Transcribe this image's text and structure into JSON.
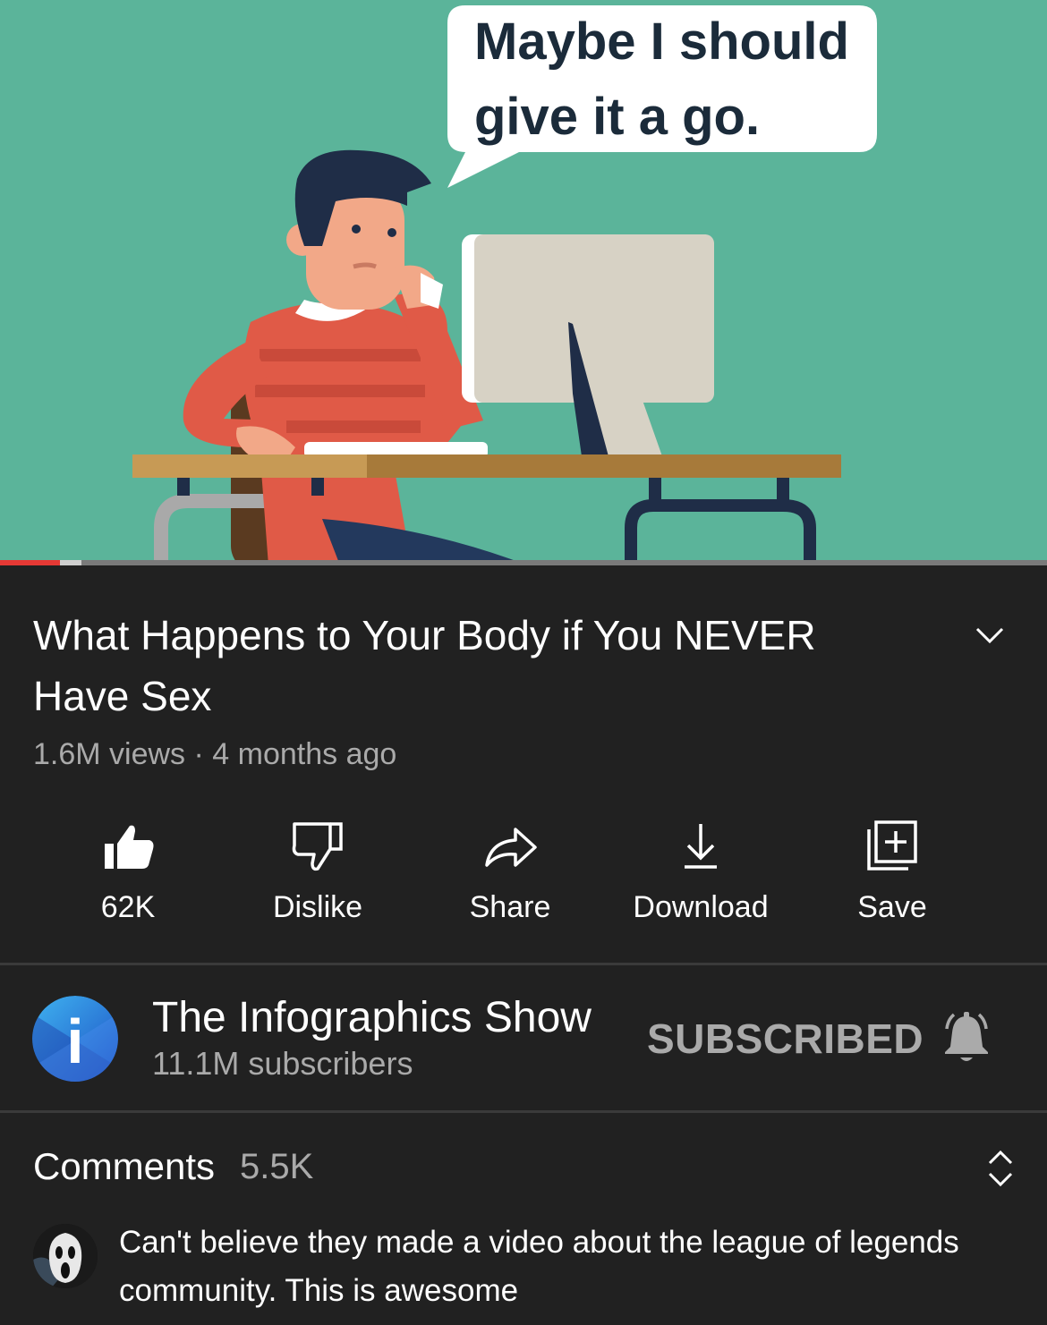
{
  "thumbnail": {
    "speech_bubble": [
      "Maybe I should",
      "give it a go."
    ],
    "progress_played": 0.057,
    "progress_buffered": 0.078
  },
  "video": {
    "title": "What Happens to Your Body if You NEVER Have Sex",
    "views": "1.6M views",
    "separator": "·",
    "age": "4 months ago"
  },
  "actions": [
    {
      "label": "62K",
      "icon": "thumbs-up-icon"
    },
    {
      "label": "Dislike",
      "icon": "thumbs-down-icon"
    },
    {
      "label": "Share",
      "icon": "share-arrow-icon"
    },
    {
      "label": "Download",
      "icon": "download-icon"
    },
    {
      "label": "Save",
      "icon": "add-to-playlist-icon"
    }
  ],
  "channel": {
    "name": "The Infographics Show",
    "subscribers": "11.1M subscribers",
    "subscribe_state": "SUBSCRIBED",
    "avatar_letter": "i"
  },
  "comments": {
    "header": "Comments",
    "count": "5.5K",
    "top_comment": "Can't believe they made a video about the league of legends community. This is awesome"
  },
  "colors": {
    "background": "#212121",
    "thumbnail_bg": "#5bb49a",
    "progress_red": "#e53935",
    "secondary_text": "#aaaaaa"
  }
}
